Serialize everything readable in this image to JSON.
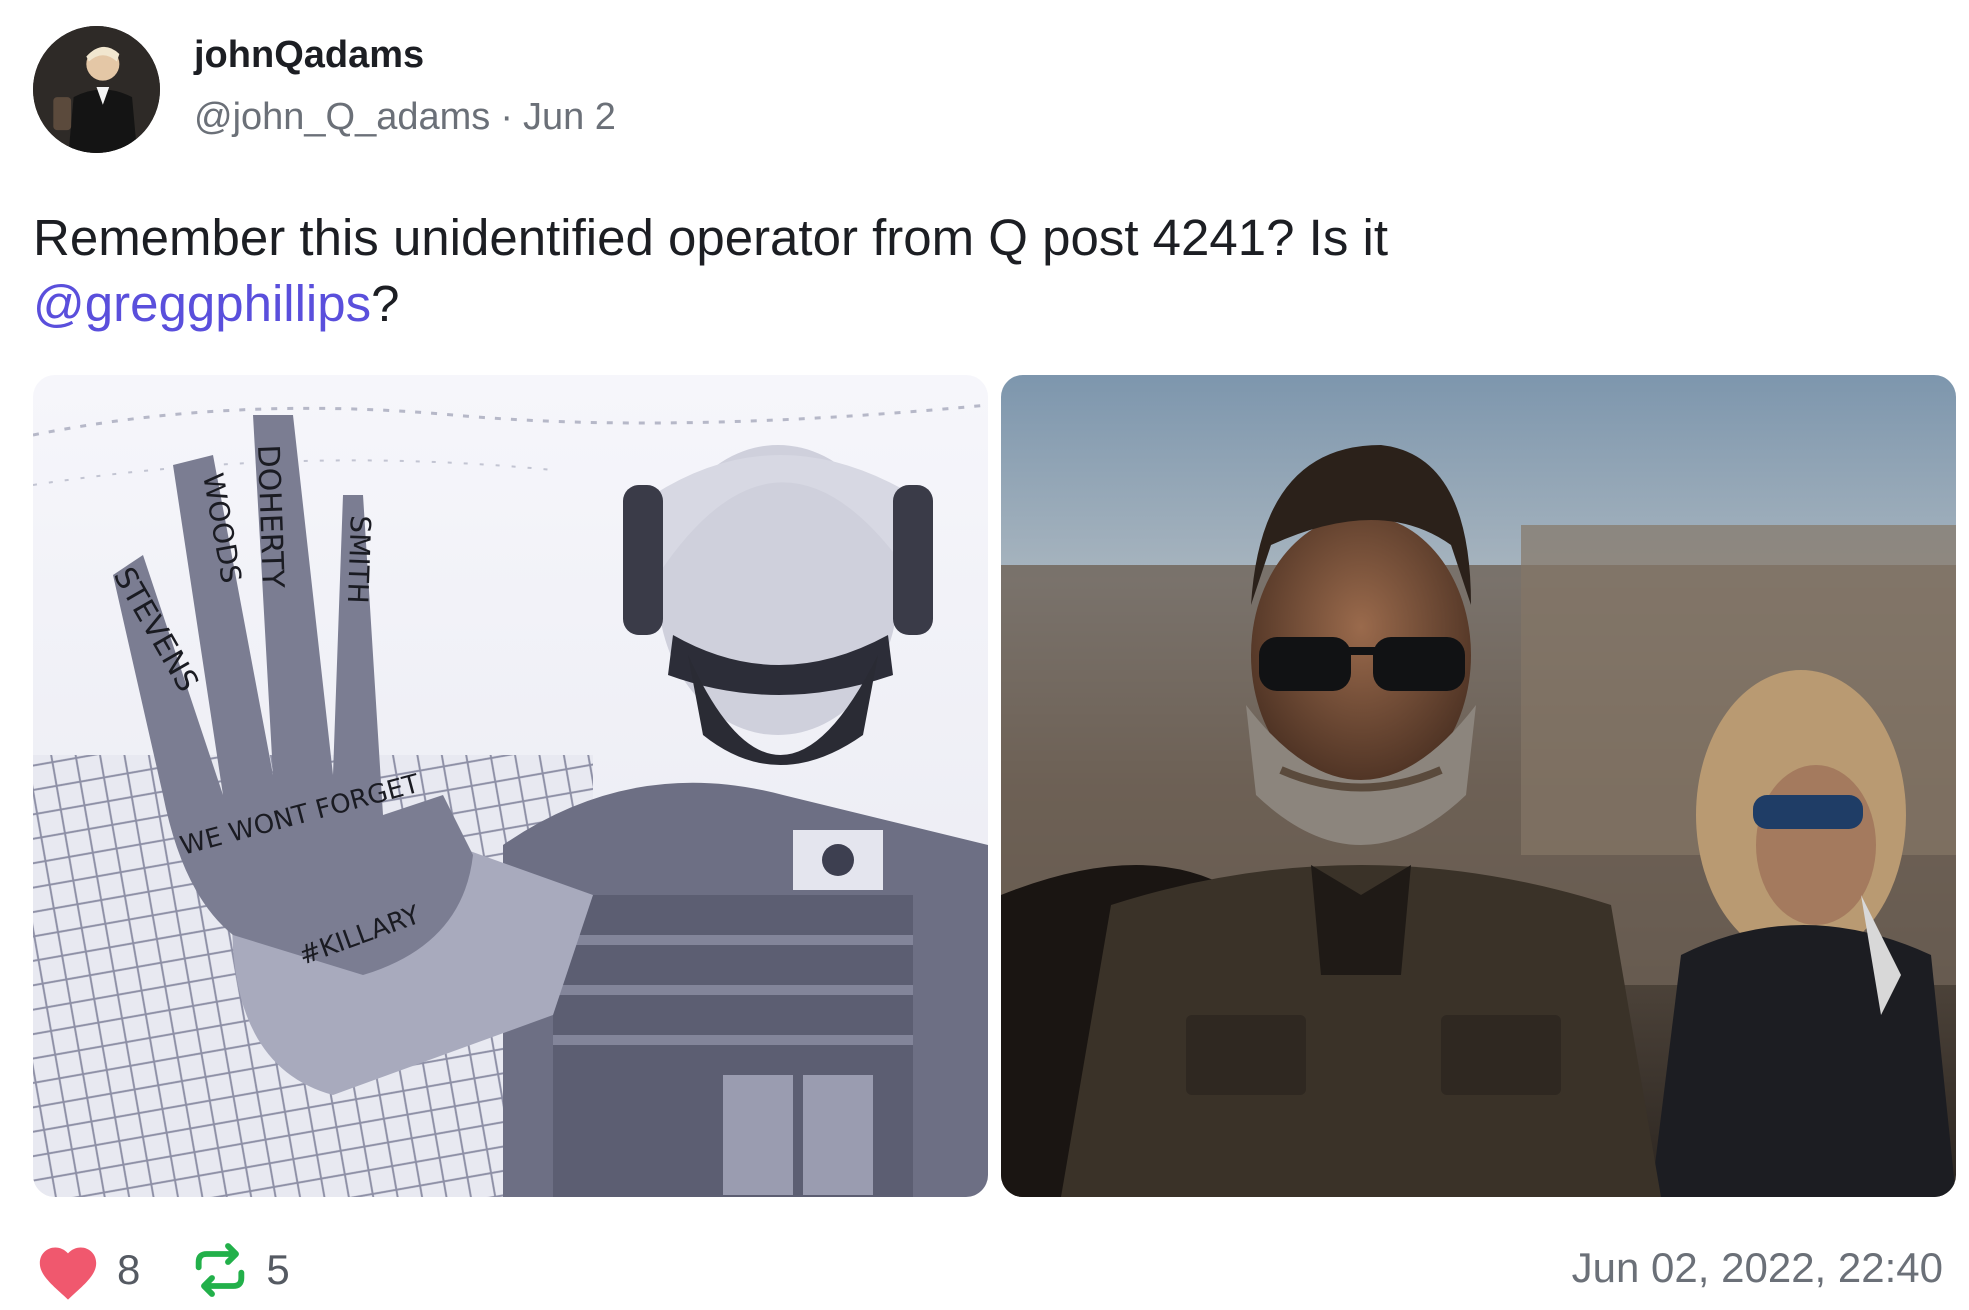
{
  "post": {
    "author": {
      "display_name": "johnQadams",
      "handle": "@john_Q_adams",
      "date_short": "Jun 2"
    },
    "text": {
      "line1": "Remember this unidentified operator from Q post 4241? Is it",
      "mention": "@greggphillips",
      "after_mention": "?"
    },
    "media": [
      {
        "type": "image",
        "style": "black-and-white",
        "icon": "photo-operator-hand"
      },
      {
        "type": "image",
        "style": "color",
        "icon": "photo-bearded-man"
      }
    ],
    "media_handwriting": [
      "STEVENS",
      "WOODS",
      "DOHERTY",
      "SMITH",
      "WE WONT FORGET",
      "#KILLARY"
    ],
    "stats": {
      "likes": "8",
      "reposts": "5"
    },
    "timestamp": "Jun 02, 2022, 22:40"
  },
  "colors": {
    "accent": "#5a4fdc",
    "like": "#f0586e",
    "repost": "#22b04a",
    "muted": "#6b7078"
  }
}
